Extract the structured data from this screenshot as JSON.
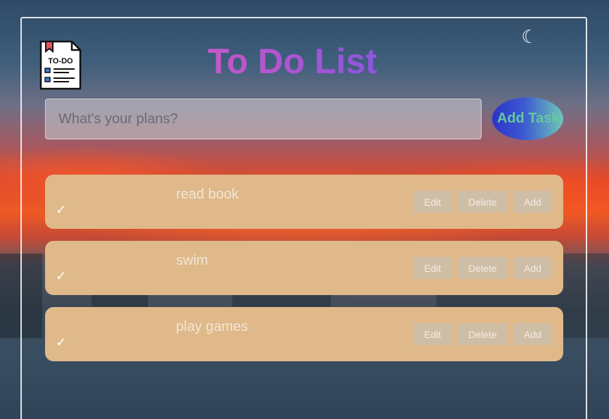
{
  "header": {
    "title": "To Do List",
    "logo_text": "TO-DO",
    "logo_icon": "todo-list-icon",
    "theme_icon": "moon-icon"
  },
  "input": {
    "placeholder": "What's your plans?",
    "value": "",
    "add_label": "Add Task"
  },
  "tasks": [
    {
      "text": "read book",
      "check": "✓",
      "edit_label": "Edit",
      "delete_label": "Delete",
      "add_label": "Add"
    },
    {
      "text": "swim",
      "check": "✓",
      "edit_label": "Edit",
      "delete_label": "Delete",
      "add_label": "Add"
    },
    {
      "text": "play games",
      "check": "✓",
      "edit_label": "Edit",
      "delete_label": "Delete",
      "add_label": "Add"
    }
  ],
  "colors": {
    "title_gradient_start": "#c558c8",
    "title_gradient_end": "#8a56e0",
    "task_background": "#dfb98a",
    "add_button_start": "#2b33c8",
    "add_button_end": "#6ec6b8"
  }
}
